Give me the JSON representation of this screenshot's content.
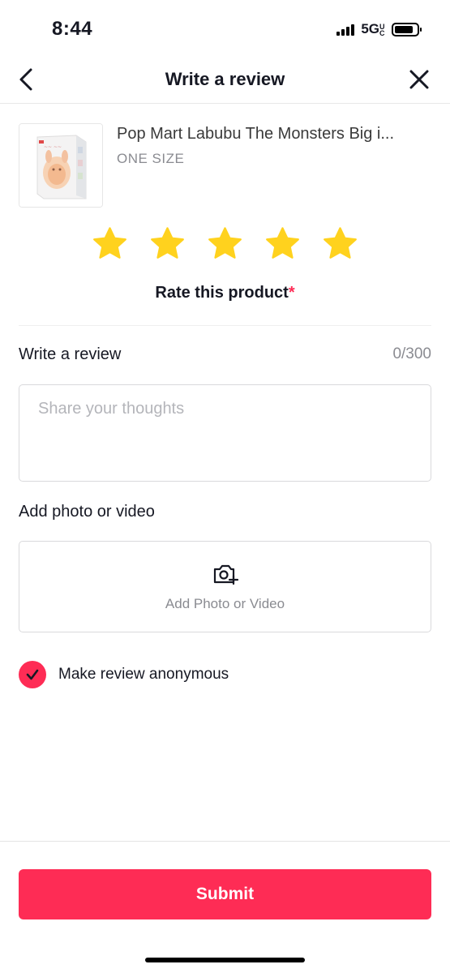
{
  "status_bar": {
    "time": "8:44",
    "network": "5G",
    "network_suffix": "UC"
  },
  "header": {
    "title": "Write a review",
    "back_icon": "chevron-left-icon",
    "close_icon": "close-icon"
  },
  "product": {
    "name": "Pop Mart Labubu The Monsters Big i...",
    "variant": "ONE SIZE"
  },
  "rating": {
    "value": 5,
    "max": 5,
    "label": "Rate this product",
    "required_marker": "*",
    "star_color": "#FFD21E"
  },
  "review": {
    "label": "Write a review",
    "char_count": "0/300",
    "value": "",
    "placeholder": "Share your thoughts"
  },
  "media": {
    "label": "Add photo or video",
    "upload_label": "Add Photo or Video",
    "icon": "camera-add-icon"
  },
  "anonymous": {
    "label": "Make review anonymous",
    "checked": true
  },
  "submit": {
    "label": "Submit"
  },
  "colors": {
    "accent": "#FE2C55",
    "text": "#161823",
    "muted": "#8A8B91",
    "border": "#D9D9DC"
  }
}
